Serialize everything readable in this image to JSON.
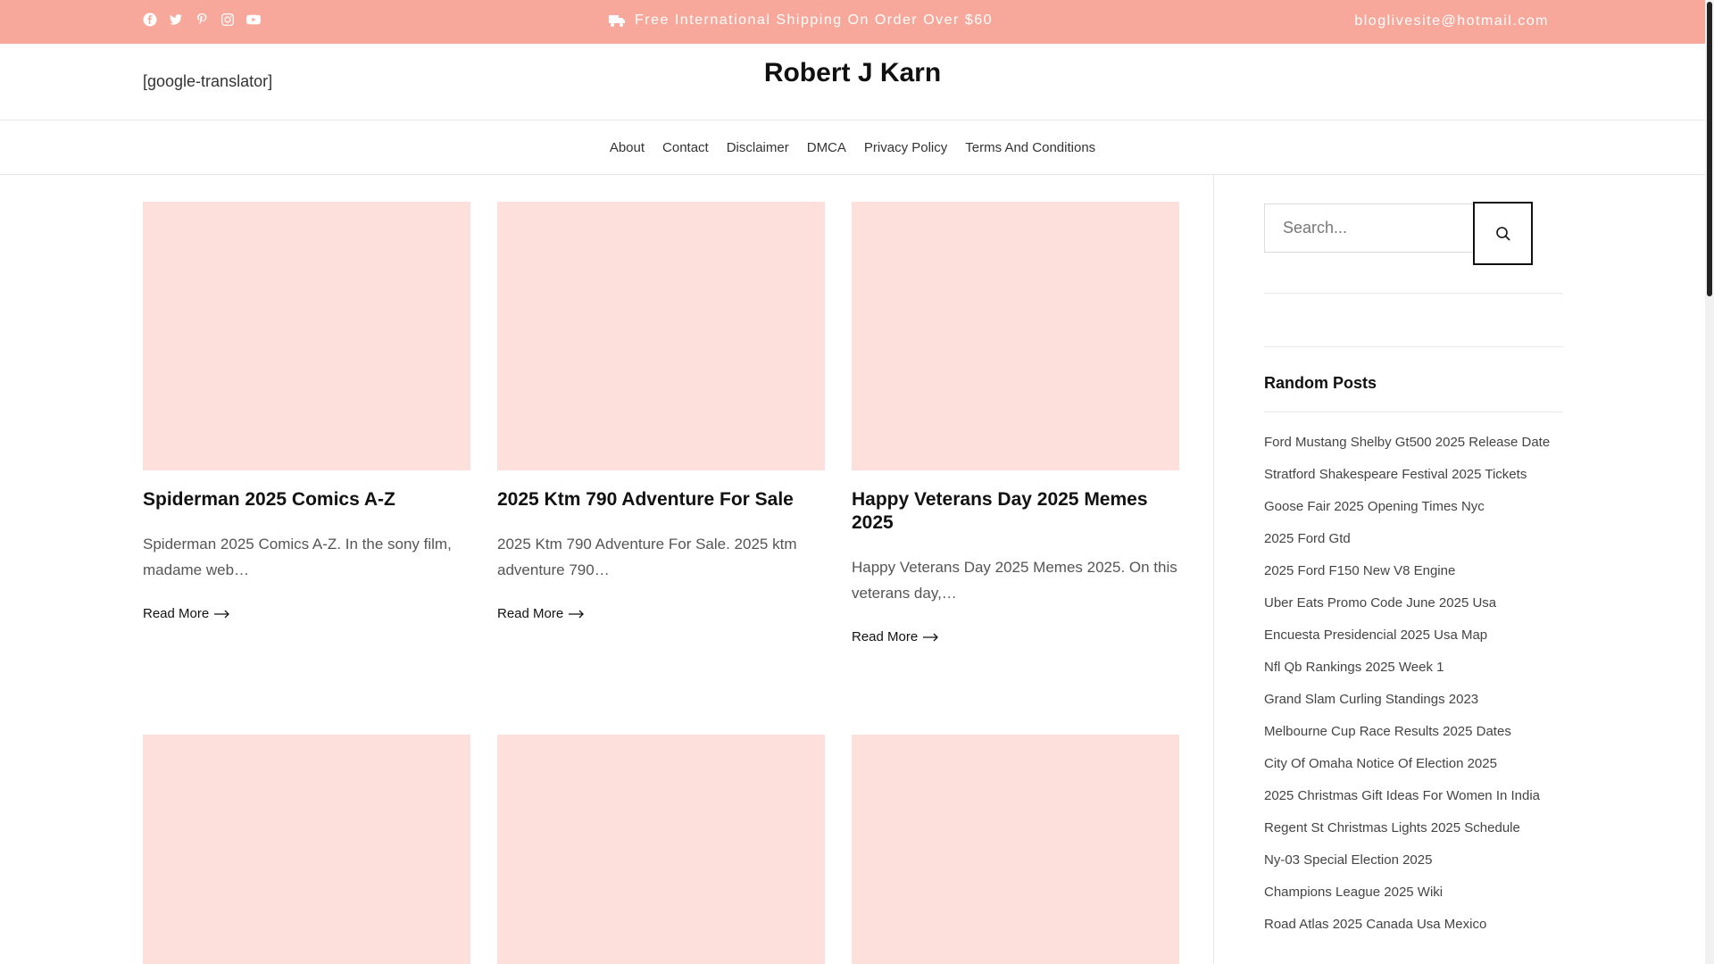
{
  "topbar": {
    "social_icons": [
      "facebook-icon",
      "twitter-icon",
      "pinterest-icon",
      "instagram-icon",
      "youtube-icon"
    ],
    "shipping_text": "Free International Shipping On Order Over $60",
    "email": "bloglivesite@hotmail.com",
    "bg_color": "#f7a89b"
  },
  "header": {
    "translator": "[google-translator]",
    "site_title": "Robert J Karn"
  },
  "nav": {
    "items": [
      "About",
      "Contact",
      "Disclaimer",
      "DMCA",
      "Privacy Policy",
      "Terms And Conditions"
    ]
  },
  "posts": [
    {
      "title": "Spiderman 2025 Comics A-Z",
      "excerpt": "Spiderman 2025 Comics A-Z. In the sony film, madame web…",
      "read_more": "Read More"
    },
    {
      "title": "2025 Ktm 790 Adventure For Sale",
      "excerpt": "2025 Ktm 790 Adventure For Sale. 2025 ktm adventure 790…",
      "read_more": "Read More"
    },
    {
      "title": "Happy Veterans Day 2025 Memes 2025",
      "excerpt": "Happy Veterans Day 2025 Memes 2025. On this veterans day,…",
      "read_more": "Read More"
    }
  ],
  "sidebar": {
    "search_placeholder": "Search...",
    "random_title": "Random Posts",
    "random_posts": [
      "Ford Mustang Shelby Gt500 2025 Release Date",
      "Stratford Shakespeare Festival 2025 Tickets",
      "Goose Fair 2025 Opening Times Nyc",
      "2025 Ford Gtd",
      "2025 Ford F150 New V8 Engine",
      "Uber Eats Promo Code June 2025 Usa",
      "Encuesta Presidencial 2025 Usa Map",
      "Nfl Qb Rankings 2025 Week 1",
      "Grand Slam Curling Standings 2023",
      "Melbourne Cup Race Results 2025 Dates",
      "City Of Omaha Notice Of Election 2025",
      "2025 Christmas Gift Ideas For Women In India",
      "Regent St Christmas Lights 2025 Schedule",
      "Ny-03 Special Election 2025",
      "Champions League 2025 Wiki",
      "Road Atlas 2025 Canada Usa Mexico"
    ]
  },
  "colors": {
    "accent": "#f7a89b",
    "thumb_placeholder": "#fde0dc"
  }
}
